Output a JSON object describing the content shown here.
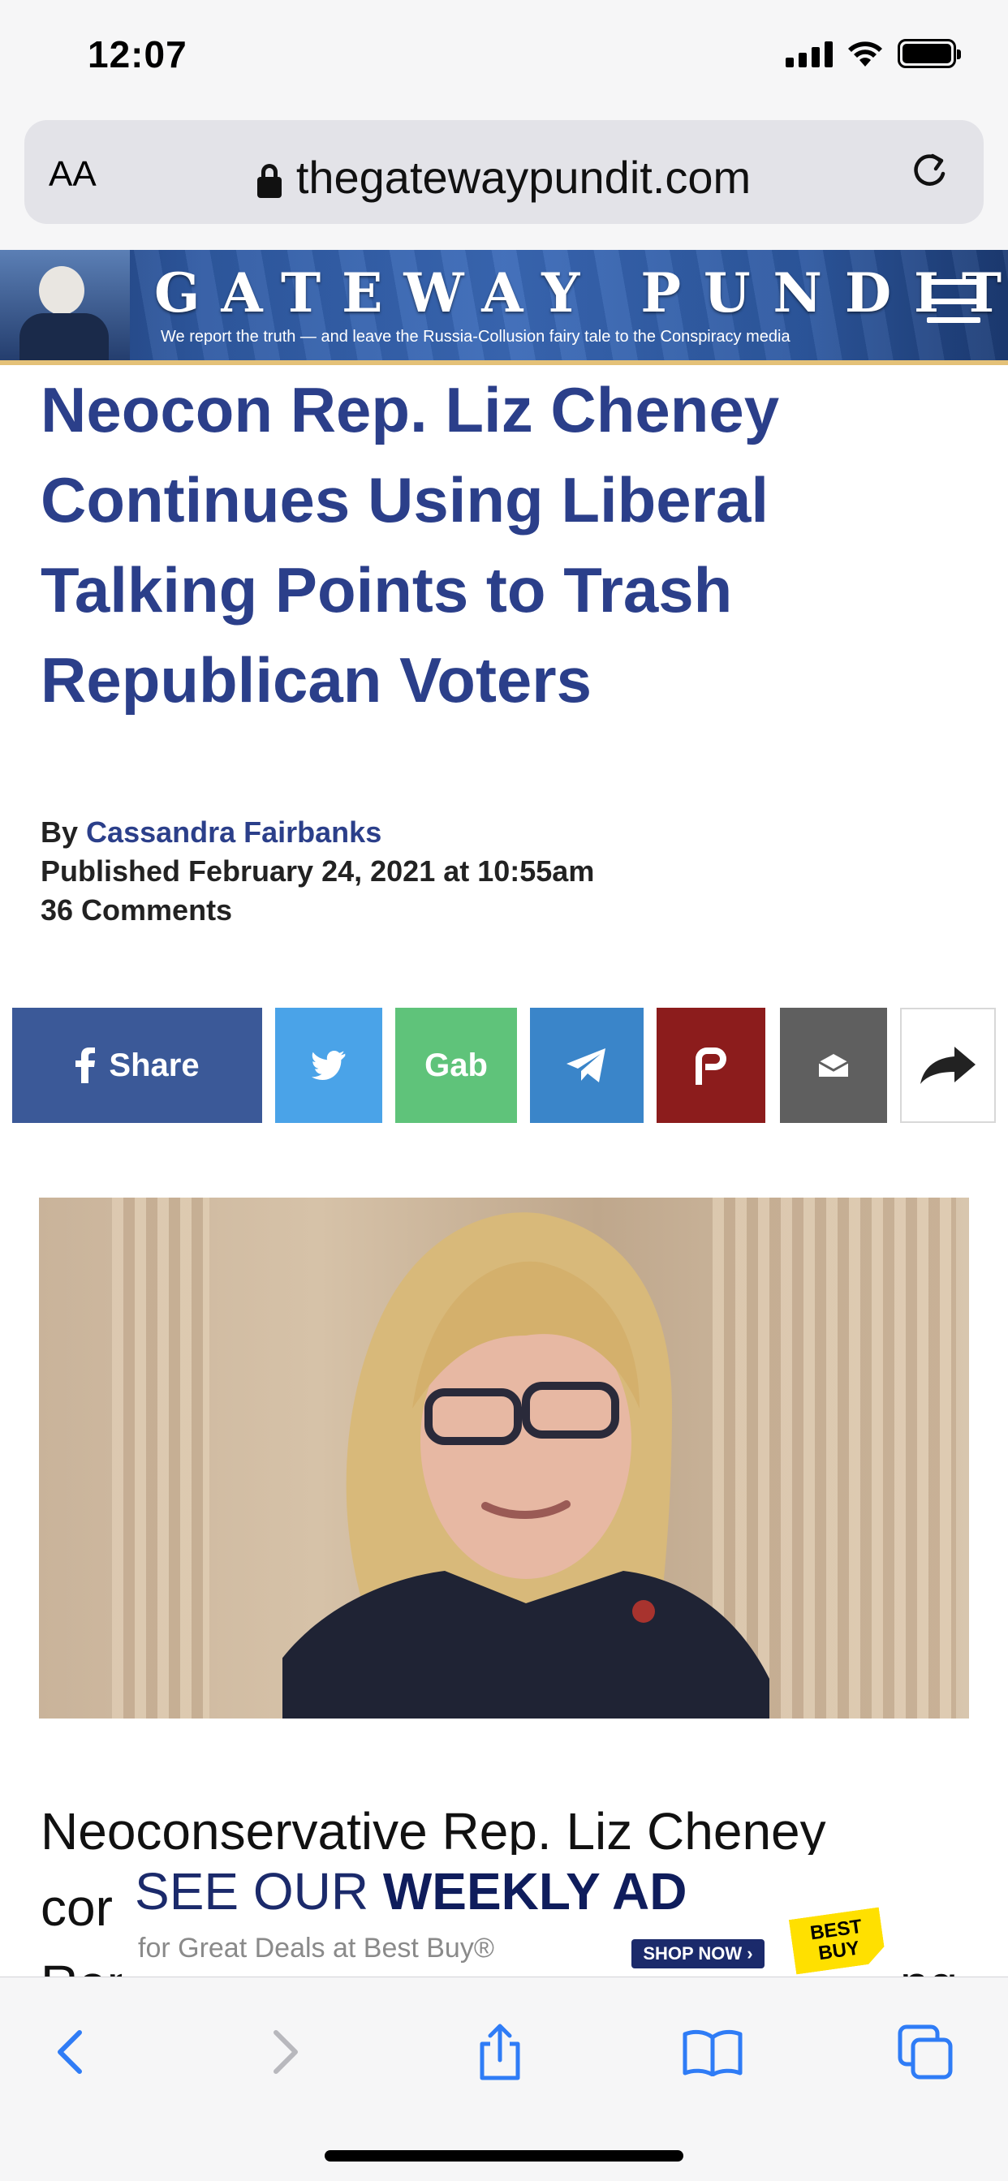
{
  "status_bar": {
    "time": "12:07"
  },
  "browser": {
    "text_size_label": "AA",
    "url": "thegatewaypundit.com"
  },
  "site": {
    "logo_word1": "GATEWAY",
    "logo_word2": "PUNDIT",
    "tagline": "We report the truth — and leave the Russia-Collusion fairy tale to the Conspiracy media"
  },
  "article": {
    "headline": "Neocon Rep. Liz Cheney Continues Using Liberal Talking Points to Trash Republican Voters",
    "by_label": "By",
    "author": "Cassandra Fairbanks",
    "published": "Published February 24, 2021 at 10:55am",
    "comments": "36 Comments",
    "body_line1": "Neoconservative Rep. Liz Cheney",
    "body_line2_start": "cor",
    "body_line3_start": "Rep",
    "body_line3_end": "ng"
  },
  "share": {
    "facebook_label": "Share",
    "gab_label": "Gab",
    "colors": {
      "facebook": "#3b5998",
      "twitter": "#4aa3e8",
      "gab": "#5fc37a",
      "telegram": "#3a85c9",
      "parler": "#8c1c1c",
      "email": "#5f5f5f"
    }
  },
  "ad": {
    "title_light": "SEE OUR ",
    "title_bold": "WEEKLY AD",
    "subtitle": "for Great Deals at Best Buy®",
    "cta": "SHOP NOW ›",
    "logo_line1": "BEST",
    "logo_line2": "BUY"
  },
  "icons": [
    "signal-icon",
    "wifi-icon",
    "battery-icon",
    "lock-icon",
    "reload-icon",
    "menu-icon",
    "facebook-icon",
    "twitter-icon",
    "telegram-icon",
    "parler-icon",
    "email-icon",
    "forward-icon",
    "back-icon",
    "next-icon",
    "share-icon",
    "bookmarks-icon",
    "tabs-icon"
  ]
}
